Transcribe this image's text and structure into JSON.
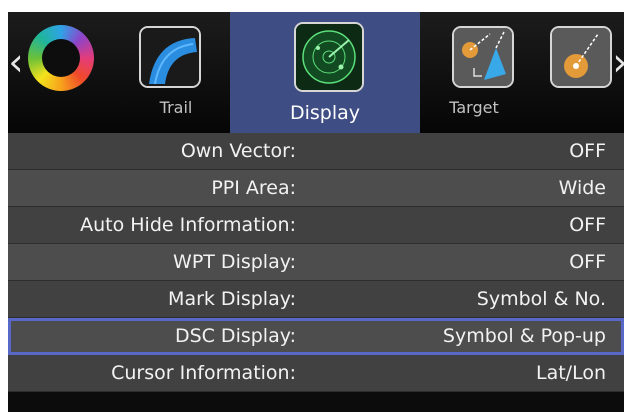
{
  "tabs": [
    {
      "label": "Trail",
      "icon": "trail-icon"
    },
    {
      "label": "Display",
      "icon": "radar-display-icon"
    },
    {
      "label": "Target",
      "icon": "target-icon"
    }
  ],
  "settings": [
    {
      "key": "Own Vector:",
      "value": "OFF"
    },
    {
      "key": "PPI Area:",
      "value": "Wide"
    },
    {
      "key": "Auto Hide Information:",
      "value": "OFF"
    },
    {
      "key": "WPT Display:",
      "value": "OFF"
    },
    {
      "key": "Mark Display:",
      "value": "Symbol & No."
    },
    {
      "key": "DSC Display:",
      "value": "Symbol & Pop-up"
    },
    {
      "key": "Cursor Information:",
      "value": "Lat/Lon"
    }
  ],
  "selected_row": "DSC Display:",
  "colors": {
    "active_tab": "#3e4d84",
    "selection_outline": "#5868c8",
    "row_light": "#4d4d4d",
    "row_dark": "#414141"
  }
}
